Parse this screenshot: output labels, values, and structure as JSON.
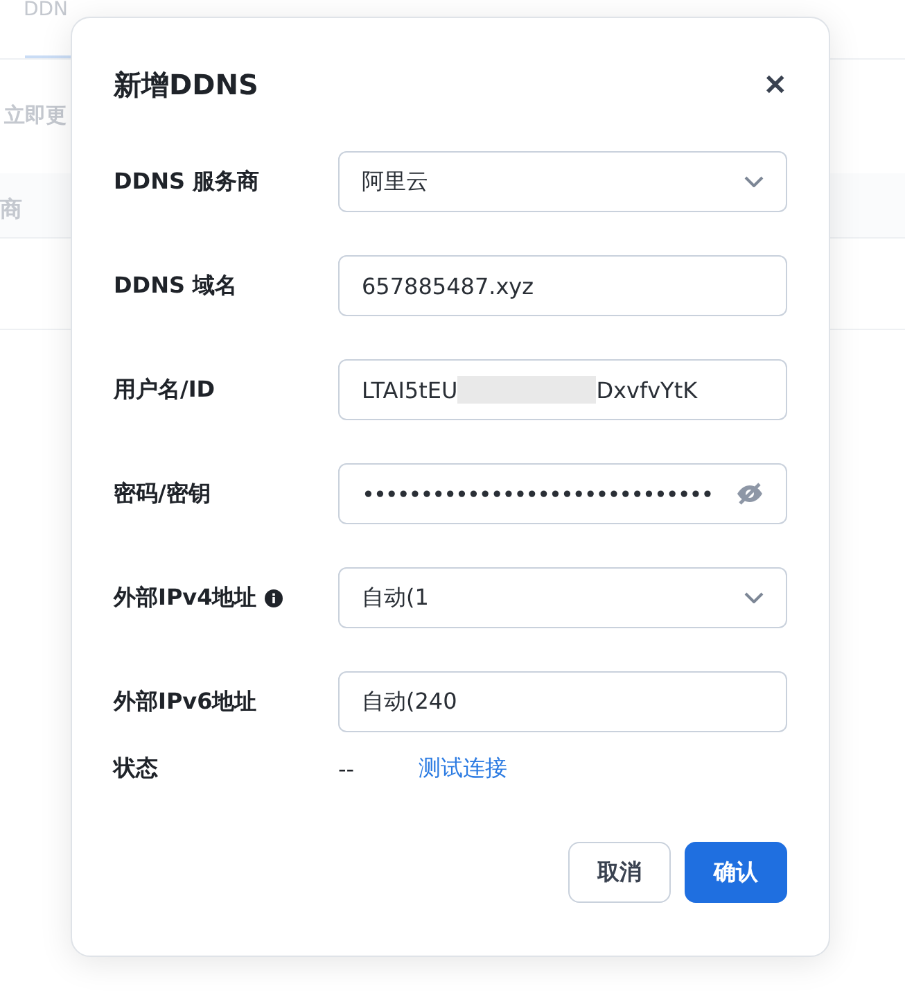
{
  "background": {
    "tab": "DDN",
    "button": "立即更",
    "column_header": "商"
  },
  "dialog": {
    "title": "新增DDNS",
    "close": "✕",
    "fields": [
      {
        "kind": "select",
        "label": "DDNS 服务商",
        "value": "阿里云"
      },
      {
        "kind": "text",
        "label": "DDNS 域名",
        "value": "657885487.xyz"
      },
      {
        "kind": "masked",
        "label": "用户名/ID",
        "value": "LTAI5tEU",
        "value_end": "DxvfvYtK"
      },
      {
        "kind": "password",
        "label": "密码/密钥",
        "value": "••••••••••••••••••••••••••••••"
      },
      {
        "kind": "select",
        "label": "外部IPv4地址",
        "value": "自动(1",
        "info": true
      },
      {
        "kind": "text",
        "label": "外部IPv6地址",
        "value": "自动(240"
      }
    ],
    "status": {
      "label": "状态",
      "value": "--",
      "link": "测试连接"
    },
    "buttons": [
      {
        "label": "取消",
        "primary": false
      },
      {
        "label": "确认",
        "primary": true
      }
    ]
  }
}
